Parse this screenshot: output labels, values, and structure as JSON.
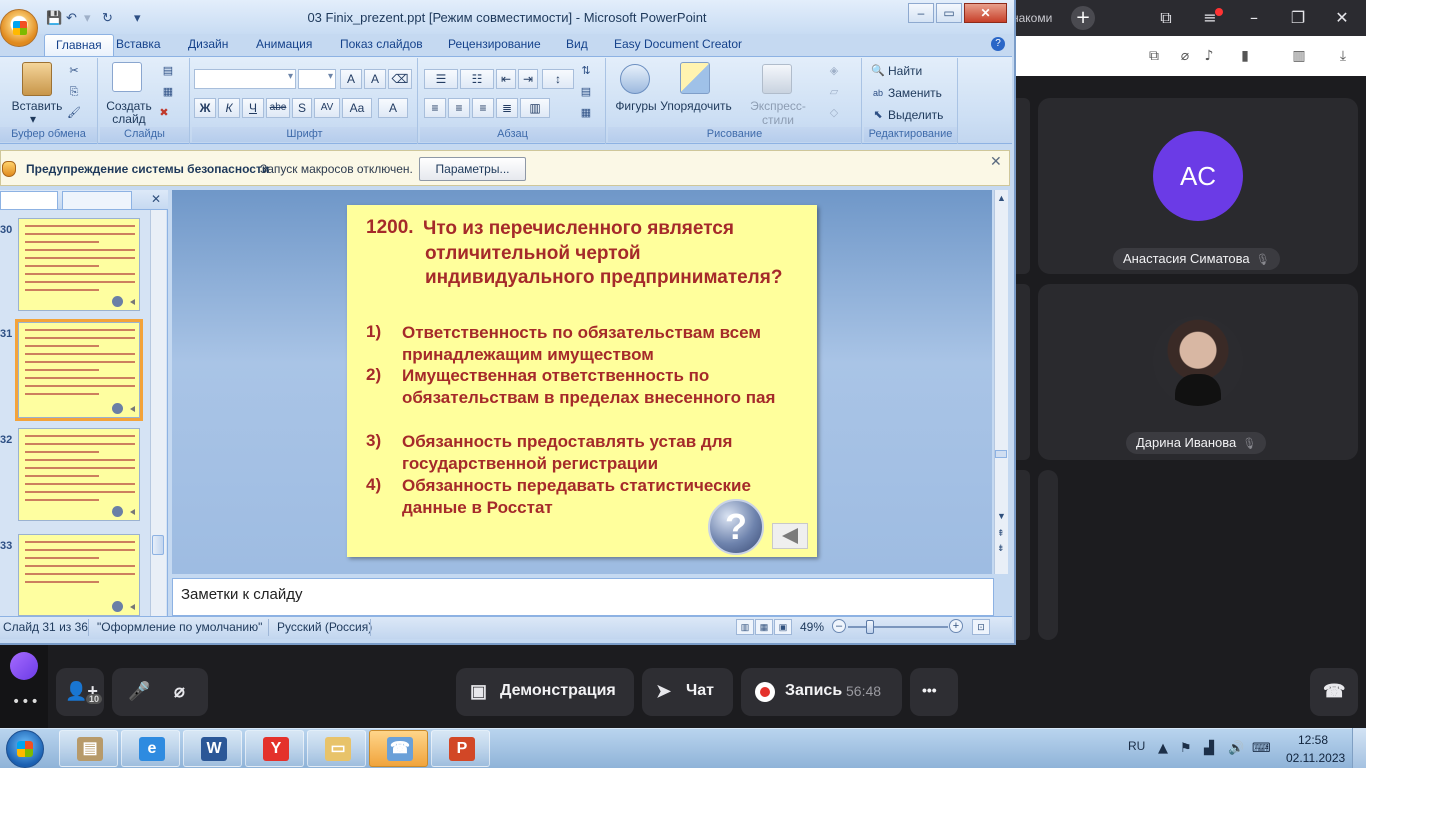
{
  "telemost": {
    "tab_tail": "накоми",
    "participants": [
      {
        "initials": "AC",
        "name": "Анастасия Симатова",
        "avatar_color": "#6b3be6"
      },
      {
        "name": "Дарина Иванова"
      }
    ],
    "add_people_badge": "10",
    "demo_label": "Демонстрация",
    "chat_label": "Чат",
    "record_label": "Запись",
    "record_time": "56:48",
    "more_label": "•••",
    "more_left": "•••"
  },
  "taskbar": {
    "lang": "RU",
    "time": "12:58",
    "date": "02.11.2023",
    "apps": [
      {
        "name": "archive",
        "glyph": "▤",
        "color": "#b79a6a"
      },
      {
        "name": "internet-explorer",
        "glyph": "e",
        "color": "#2e8be0"
      },
      {
        "name": "word",
        "glyph": "W",
        "color": "#2b5797"
      },
      {
        "name": "yandex-browser",
        "glyph": "Y",
        "color": "#e4312b"
      },
      {
        "name": "explorer",
        "glyph": "▭",
        "color": "#e8c36a"
      },
      {
        "name": "phone-app",
        "glyph": "☎",
        "color": "#6aa0d8"
      },
      {
        "name": "powerpoint",
        "glyph": "P",
        "color": "#d24726"
      }
    ]
  },
  "ppt": {
    "title": "03 Finix_prezent.ppt [Режим совместимости] - Microsoft PowerPoint",
    "tabs": [
      "Главная",
      "Вставка",
      "Дизайн",
      "Анимация",
      "Показ слайдов",
      "Рецензирование",
      "Вид",
      "Easy Document Creator"
    ],
    "ribbon": {
      "clipboard_group": "Буфер обмена",
      "paste": "Вставить",
      "slides_group": "Слайды",
      "create_slide": "Создать",
      "create_slide_2": "слайд",
      "font_group": "Шрифт",
      "paragraph_group": "Абзац",
      "drawing_group": "Рисование",
      "shapes": "Фигуры",
      "arrange": "Упорядочить",
      "quick_styles": "Экспресс-стили",
      "editing_group": "Редактирование",
      "find": "Найти",
      "replace": "Заменить",
      "select": "Выделить",
      "bold": "Ж",
      "italic": "К",
      "underline": "Ч",
      "strike": "abe",
      "shadow": "S",
      "spacing": "AV",
      "case": "Aa",
      "color": "A"
    },
    "security": {
      "title": "Предупреждение системы безопасности",
      "message": "Запуск макросов отключен.",
      "button": "Параметры..."
    },
    "thumbnails": [
      {
        "num": "30"
      },
      {
        "num": "31"
      },
      {
        "num": "32"
      },
      {
        "num": "33"
      }
    ],
    "slide": {
      "number": "1200.",
      "question": "Что из перечисленного является отличительной чертой индивидуального предпринимателя?",
      "answers": [
        {
          "num": "1)",
          "text": "Ответственность по обязательствам всем принадлежащим имуществом"
        },
        {
          "num": "2)",
          "text": "Имущественная ответственность по обязательствам в пределах внесенного пая"
        },
        {
          "num": "3)",
          "text": "Обязанность предоставлять устав для государственной регистрации"
        },
        {
          "num": "4)",
          "text": "Обязанность передавать статистические данные в Росстат"
        }
      ],
      "help_glyph": "?"
    },
    "notes_placeholder": "Заметки к слайду",
    "status": {
      "slide_info": "Слайд 31 из 36",
      "theme": "\"Оформление по умолчанию\"",
      "language": "Русский (Россия)",
      "zoom": "49%"
    }
  }
}
